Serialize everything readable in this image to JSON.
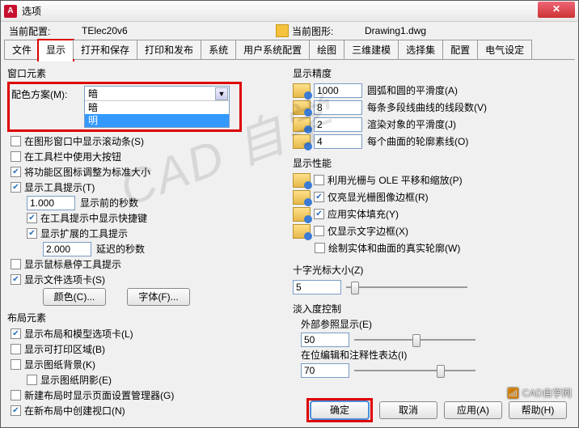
{
  "window": {
    "title": "选项",
    "app_badge": "A"
  },
  "config": {
    "current_profile_label": "当前配置:",
    "current_profile_value": "TElec20v6",
    "current_drawing_label": "当前图形:",
    "current_drawing_value": "Drawing1.dwg"
  },
  "tabs": [
    "文件",
    "显示",
    "打开和保存",
    "打印和发布",
    "系统",
    "用户系统配置",
    "绘图",
    "三维建模",
    "选择集",
    "配置",
    "电气设定"
  ],
  "active_tab_index": 1,
  "left": {
    "window_elements_title": "窗口元素",
    "color_scheme_label": "配色方案(M):",
    "color_scheme_selected": "暗",
    "color_scheme_options": [
      "暗",
      "明"
    ],
    "cb_scrollbar": "在图形窗口中显示滚动条(S)",
    "cb_toolbar_bigbtn": "在工具栏中使用大按钮",
    "cb_ribbon_std": "将功能区图标调整为标准大小",
    "cb_tooltip": "显示工具提示(T)",
    "tooltip_delay_value": "1.000",
    "tooltip_delay_label": "显示前的秒数",
    "cb_shortcut": "在工具提示中显示快捷键",
    "cb_ext_tooltip": "显示扩展的工具提示",
    "ext_delay_value": "2.000",
    "ext_delay_label": "延迟的秒数",
    "cb_hover_tooltip": "显示鼠标悬停工具提示",
    "cb_filetabs": "显示文件选项卡(S)",
    "btn_colors": "颜色(C)...",
    "btn_fonts": "字体(F)...",
    "layout_title": "布局元素",
    "cb_layout_tabs": "显示布局和模型选项卡(L)",
    "cb_printable": "显示可打印区域(B)",
    "cb_paper_bg": "显示图纸背景(K)",
    "cb_paper_shadow": "显示图纸阴影(E)",
    "cb_new_layout_mgr": "新建布局时显示页面设置管理器(G)",
    "cb_create_vp": "在新布局中创建视口(N)"
  },
  "right": {
    "precision_title": "显示精度",
    "prec_arc_value": "1000",
    "prec_arc_label": "圆弧和圆的平滑度(A)",
    "prec_seg_value": "8",
    "prec_seg_label": "每条多段线曲线的线段数(V)",
    "prec_render_value": "2",
    "prec_render_label": "渲染对象的平滑度(J)",
    "prec_surf_value": "4",
    "prec_surf_label": "每个曲面的轮廓素线(O)",
    "perf_title": "显示性能",
    "cb_pan_raster": "利用光栅与 OLE 平移和缩放(P)",
    "cb_raster_frame": "仅亮显光栅图像边框(R)",
    "cb_solid_fill": "应用实体填充(Y)",
    "cb_text_frame": "仅显示文字边框(X)",
    "cb_silhouette": "绘制实体和曲面的真实轮廓(W)",
    "cross_title": "十字光标大小(Z)",
    "cross_value": "5",
    "fade_title": "淡入度控制",
    "xref_label": "外部参照显示(E)",
    "xref_value": "50",
    "inplace_label": "在位编辑和注释性表达(I)",
    "inplace_value": "70"
  },
  "buttons": {
    "ok": "确定",
    "cancel": "取消",
    "apply": "应用(A)",
    "help": "帮助(H)"
  },
  "watermark": "CAD 自学",
  "corner_mark": "📶 CAD自学网"
}
